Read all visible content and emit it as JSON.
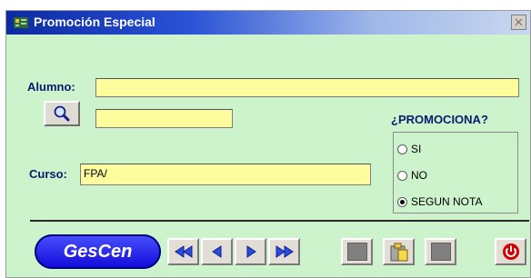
{
  "window": {
    "title": "Promoción Especial",
    "close_glyph": "✕"
  },
  "form": {
    "alumno_label": "Alumno:",
    "alumno_value": "",
    "alumno_code_value": "",
    "curso_label": "Curso:",
    "curso_value": "FPA/"
  },
  "promociona": {
    "label": "¿PROMOCIONA?",
    "options": [
      {
        "label": "SI",
        "selected": false
      },
      {
        "label": "NO",
        "selected": false
      },
      {
        "label": "SEGUN NOTA",
        "selected": true
      }
    ]
  },
  "toolbar": {
    "logo_text": "GesCen",
    "icons": [
      "first-record-icon",
      "previous-record-icon",
      "next-record-icon",
      "last-record-icon",
      "save-icon",
      "paste-icon",
      "delete-icon",
      "power-icon"
    ]
  },
  "colors": {
    "field_bg": "#fffc9e",
    "window_bg": "#ccf3cc",
    "title_bar": "#0c2aa3",
    "label": "#0a1a6e",
    "logo": "#1a16e8",
    "power": "#d20000"
  }
}
